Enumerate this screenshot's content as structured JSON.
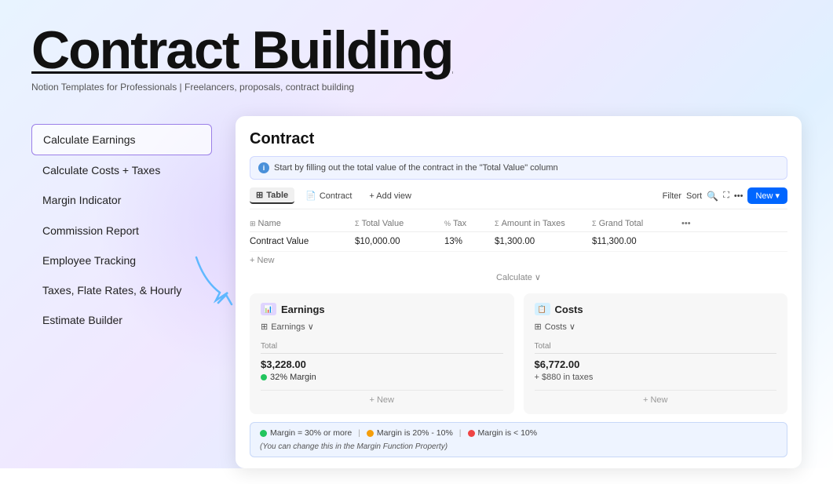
{
  "header": {
    "title": "Contract Building",
    "subtitle": "Notion Templates for Professionals | Freelancers, proposals, contract building"
  },
  "nav": {
    "items": [
      {
        "id": "calculate-earnings",
        "label": "Calculate Earnings",
        "active": true
      },
      {
        "id": "calculate-costs",
        "label": "Calculate Costs + Taxes",
        "active": false
      },
      {
        "id": "margin-indicator",
        "label": "Margin Indicator",
        "active": false
      },
      {
        "id": "commission-report",
        "label": "Commission Report",
        "active": false
      },
      {
        "id": "employee-tracking",
        "label": "Employee Tracking",
        "active": false
      },
      {
        "id": "taxes-rates",
        "label": "Taxes, Flate Rates, & Hourly",
        "active": false
      },
      {
        "id": "estimate-builder",
        "label": "Estimate Builder",
        "active": false
      }
    ]
  },
  "contract": {
    "title": "Contract",
    "info_bar": "Start by filling out the total value of the contract in the \"Total Value\" column",
    "toolbar": {
      "tabs": [
        {
          "label": "Table",
          "active": true
        },
        {
          "label": "Contract",
          "active": false
        }
      ],
      "add_view": "+ Add view",
      "filter": "Filter",
      "sort": "Sort",
      "new_label": "New"
    },
    "table": {
      "columns": [
        "Name",
        "Total Value",
        "Tax",
        "Amount in Taxes",
        "Grand Total",
        ""
      ],
      "rows": [
        {
          "name": "Contract Value",
          "total_value": "$10,000.00",
          "tax": "13%",
          "amount_in_taxes": "$1,300.00",
          "grand_total": "$11,300.00"
        }
      ],
      "add_new": "+ New",
      "calculate": "Calculate ∨"
    },
    "earnings_card": {
      "title": "Earnings",
      "icon": "earnings-icon",
      "subheader": "Earnings ∨",
      "table_col": "Total",
      "value": "$3,228.00",
      "margin_label": "32% Margin",
      "add_new": "+ New"
    },
    "costs_card": {
      "title": "Costs",
      "icon": "costs-icon",
      "subheader": "Costs ∨",
      "table_col": "Total",
      "value": "$6,772.00",
      "taxes_note": "+ $880 in taxes",
      "add_new": "+ New"
    },
    "margin_bar": {
      "items": [
        {
          "color": "green",
          "label": "Margin = 30% or more"
        },
        {
          "color": "yellow",
          "label": "Margin is 20% - 10%"
        },
        {
          "color": "red",
          "label": "Margin is < 10%"
        }
      ],
      "note": "(You can change this in the Margin Function Property)"
    }
  }
}
